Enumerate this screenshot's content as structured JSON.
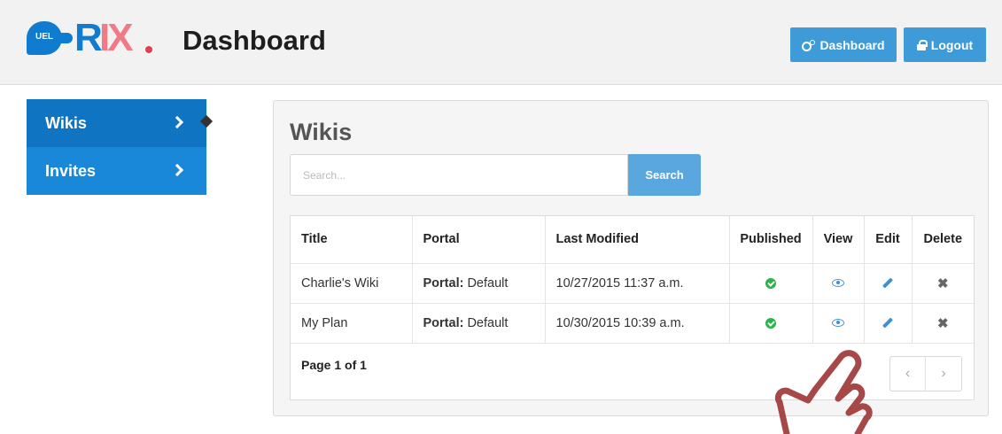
{
  "header": {
    "logo_badge": "UEL",
    "logo_r": "R",
    "logo_ix": "IX",
    "title": "Dashboard",
    "dashboard_button": "Dashboard",
    "logout_button": "Logout"
  },
  "sidebar": {
    "items": [
      {
        "label": "Wikis",
        "active": true
      },
      {
        "label": "Invites",
        "active": false
      }
    ]
  },
  "main": {
    "title": "Wikis",
    "search": {
      "placeholder": "Search...",
      "value": "",
      "button_label": "Search"
    },
    "table": {
      "columns": [
        "Title",
        "Portal",
        "Last Modified",
        "Published",
        "View",
        "Edit",
        "Delete"
      ],
      "rows": [
        {
          "title": "Charlie's Wiki",
          "portal_label": "Portal:",
          "portal_value": "Default",
          "last_modified": "10/27/2015 11:37 a.m.",
          "published": true
        },
        {
          "title": "My Plan",
          "portal_label": "Portal:",
          "portal_value": "Default",
          "last_modified": "10/30/2015 10:39 a.m.",
          "published": true
        }
      ]
    },
    "pagination": {
      "info": "Page 1 of 1",
      "prev": "‹",
      "next": "›"
    }
  },
  "icons": {
    "published": "check-circle-icon",
    "view": "eye-icon",
    "edit": "pencil-icon",
    "delete": "x-icon",
    "overlay": "hand-pointer-icon"
  },
  "colors": {
    "primary": "#1a88d9",
    "primary_dark": "#0f74c2",
    "button": "#3f9ad8",
    "success": "#2bb24c",
    "logo_accent": "#ee7b86",
    "hand": "#a64848"
  }
}
